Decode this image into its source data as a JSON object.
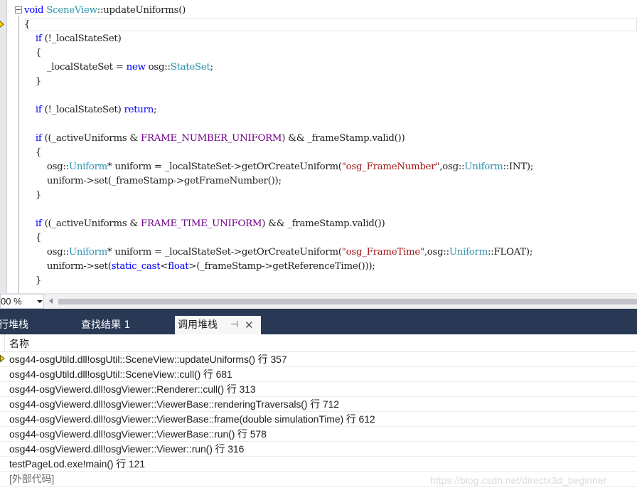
{
  "editor": {
    "lines": [
      [
        [
          "kw",
          "void"
        ],
        [
          "t",
          " "
        ],
        [
          "ty",
          "SceneView"
        ],
        [
          "t",
          "::updateUniforms()"
        ]
      ],
      [
        [
          "t",
          "{"
        ]
      ],
      [
        [
          "t",
          "    "
        ],
        [
          "kw",
          "if"
        ],
        [
          "t",
          " (!_localStateSet)"
        ]
      ],
      [
        [
          "t",
          "    {"
        ]
      ],
      [
        [
          "t",
          "        _localStateSet = "
        ],
        [
          "kw",
          "new"
        ],
        [
          "t",
          " osg::"
        ],
        [
          "ty",
          "StateSet"
        ],
        [
          "t",
          ";"
        ]
      ],
      [
        [
          "t",
          "    }"
        ]
      ],
      [
        [
          "t",
          ""
        ]
      ],
      [
        [
          "t",
          "    "
        ],
        [
          "kw",
          "if"
        ],
        [
          "t",
          " (!_localStateSet) "
        ],
        [
          "kw",
          "return"
        ],
        [
          "t",
          ";"
        ]
      ],
      [
        [
          "t",
          ""
        ]
      ],
      [
        [
          "t",
          "    "
        ],
        [
          "kw",
          "if"
        ],
        [
          "t",
          " ((_activeUniforms & "
        ],
        [
          "mac",
          "FRAME_NUMBER_UNIFORM"
        ],
        [
          "t",
          ") && _frameStamp.valid())"
        ]
      ],
      [
        [
          "t",
          "    {"
        ]
      ],
      [
        [
          "t",
          "        osg::"
        ],
        [
          "ty",
          "Uniform"
        ],
        [
          "t",
          "* uniform = _localStateSet->getOrCreateUniform("
        ],
        [
          "str",
          "\"osg_FrameNumber\""
        ],
        [
          "t",
          ",osg::"
        ],
        [
          "ty",
          "Uniform"
        ],
        [
          "t",
          "::INT);"
        ]
      ],
      [
        [
          "t",
          "        uniform->set(_frameStamp->getFrameNumber());"
        ]
      ],
      [
        [
          "t",
          "    }"
        ]
      ],
      [
        [
          "t",
          ""
        ]
      ],
      [
        [
          "t",
          "    "
        ],
        [
          "kw",
          "if"
        ],
        [
          "t",
          " ((_activeUniforms & "
        ],
        [
          "mac",
          "FRAME_TIME_UNIFORM"
        ],
        [
          "t",
          ") && _frameStamp.valid())"
        ]
      ],
      [
        [
          "t",
          "    {"
        ]
      ],
      [
        [
          "t",
          "        osg::"
        ],
        [
          "ty",
          "Uniform"
        ],
        [
          "t",
          "* uniform = _localStateSet->getOrCreateUniform("
        ],
        [
          "str",
          "\"osg_FrameTime\""
        ],
        [
          "t",
          ",osg::"
        ],
        [
          "ty",
          "Uniform"
        ],
        [
          "t",
          "::FLOAT);"
        ]
      ],
      [
        [
          "t",
          "        uniform->set("
        ],
        [
          "kw",
          "static_cast"
        ],
        [
          "t",
          "<"
        ],
        [
          "kw",
          "float"
        ],
        [
          "t",
          ">(_frameStamp->getReferenceTime()));"
        ]
      ],
      [
        [
          "t",
          "    }"
        ]
      ]
    ],
    "zoom": "00 %",
    "colors": {
      "keyword": "#0000ff",
      "type": "#2b91af",
      "string": "#a31515",
      "macro": "#6f008a",
      "tab_strip": "#293955"
    }
  },
  "tabs": {
    "autos": "行堆栈",
    "find": "查找结果 1",
    "callstack": "调用堆栈",
    "pin_icon": "⊣",
    "close_icon": "✕"
  },
  "callstack": {
    "header": "名称",
    "current_frame_icon": "yellow-arrow",
    "rows": [
      "osg44-osgUtild.dll!osgUtil::SceneView::updateUniforms() 行 357",
      "osg44-osgUtild.dll!osgUtil::SceneView::cull() 行 681",
      "osg44-osgViewerd.dll!osgViewer::Renderer::cull() 行 313",
      "osg44-osgViewerd.dll!osgViewer::ViewerBase::renderingTraversals() 行 712",
      "osg44-osgViewerd.dll!osgViewer::ViewerBase::frame(double simulationTime) 行 612",
      "osg44-osgViewerd.dll!osgViewer::ViewerBase::run() 行 578",
      "osg44-osgViewerd.dll!osgViewer::Viewer::run() 行 316",
      "testPageLod.exe!main() 行 121",
      "[外部代码]"
    ],
    "watermark": "https://blog.csdn.net/directx3d_beginner"
  }
}
